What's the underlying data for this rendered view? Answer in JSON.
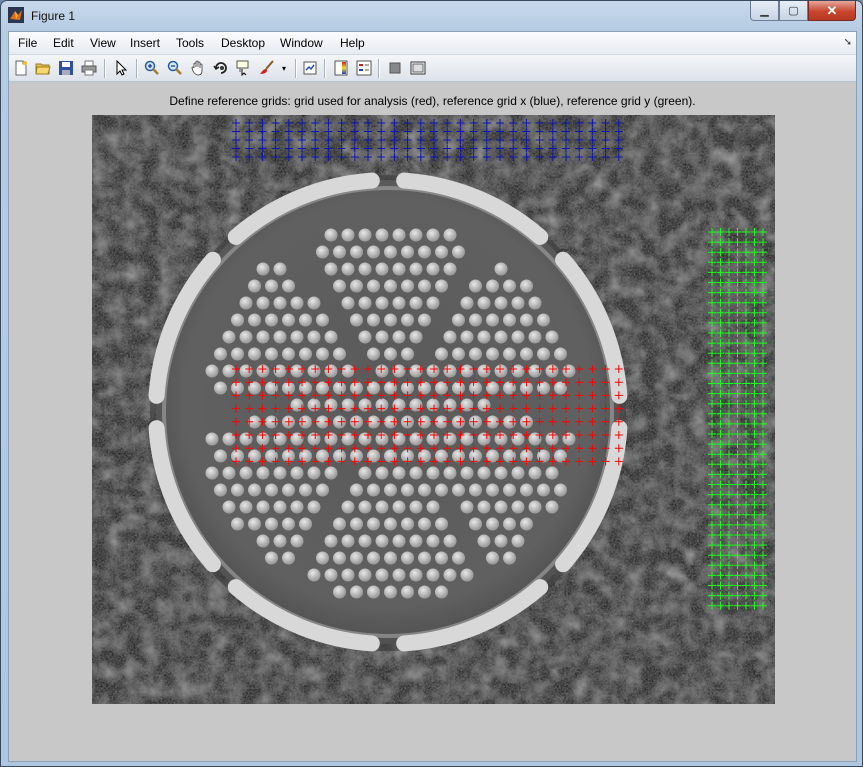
{
  "window": {
    "title": "Figure 1",
    "buttons": [
      "minimize",
      "maximize",
      "close"
    ]
  },
  "menubar": {
    "items": [
      "File",
      "Edit",
      "View",
      "Insert",
      "Tools",
      "Desktop",
      "Window",
      "Help"
    ]
  },
  "toolbar": {
    "icons": [
      "new-figure-icon",
      "open-file-icon",
      "save-icon",
      "print-icon",
      "edit-plot-icon",
      "zoom-in-icon",
      "zoom-out-icon",
      "pan-icon",
      "rotate-3d-icon",
      "data-cursor-icon",
      "brush-icon",
      "link-plot-icon",
      "colorbar-icon",
      "legend-icon",
      "hide-plot-tools-icon",
      "show-plot-tools-icon"
    ]
  },
  "axes": {
    "title": "Define reference grids: grid used for analysis (red), reference grid x (blue), reference grid y (green)."
  },
  "grids": {
    "analysis_color": "#ff0000",
    "reference_x_color": "#0a14b4",
    "reference_y_color": "#19ff19",
    "analysis": {
      "cols": 30,
      "rows": 8
    },
    "reference_x": {
      "cols": 30,
      "rows": 5
    },
    "reference_y": {
      "cols": 7,
      "rows": 38
    }
  },
  "colors": {
    "titlebar": "#b6cce3",
    "figure_bg": "#c8c8c8",
    "close_button": "#c7452e"
  }
}
